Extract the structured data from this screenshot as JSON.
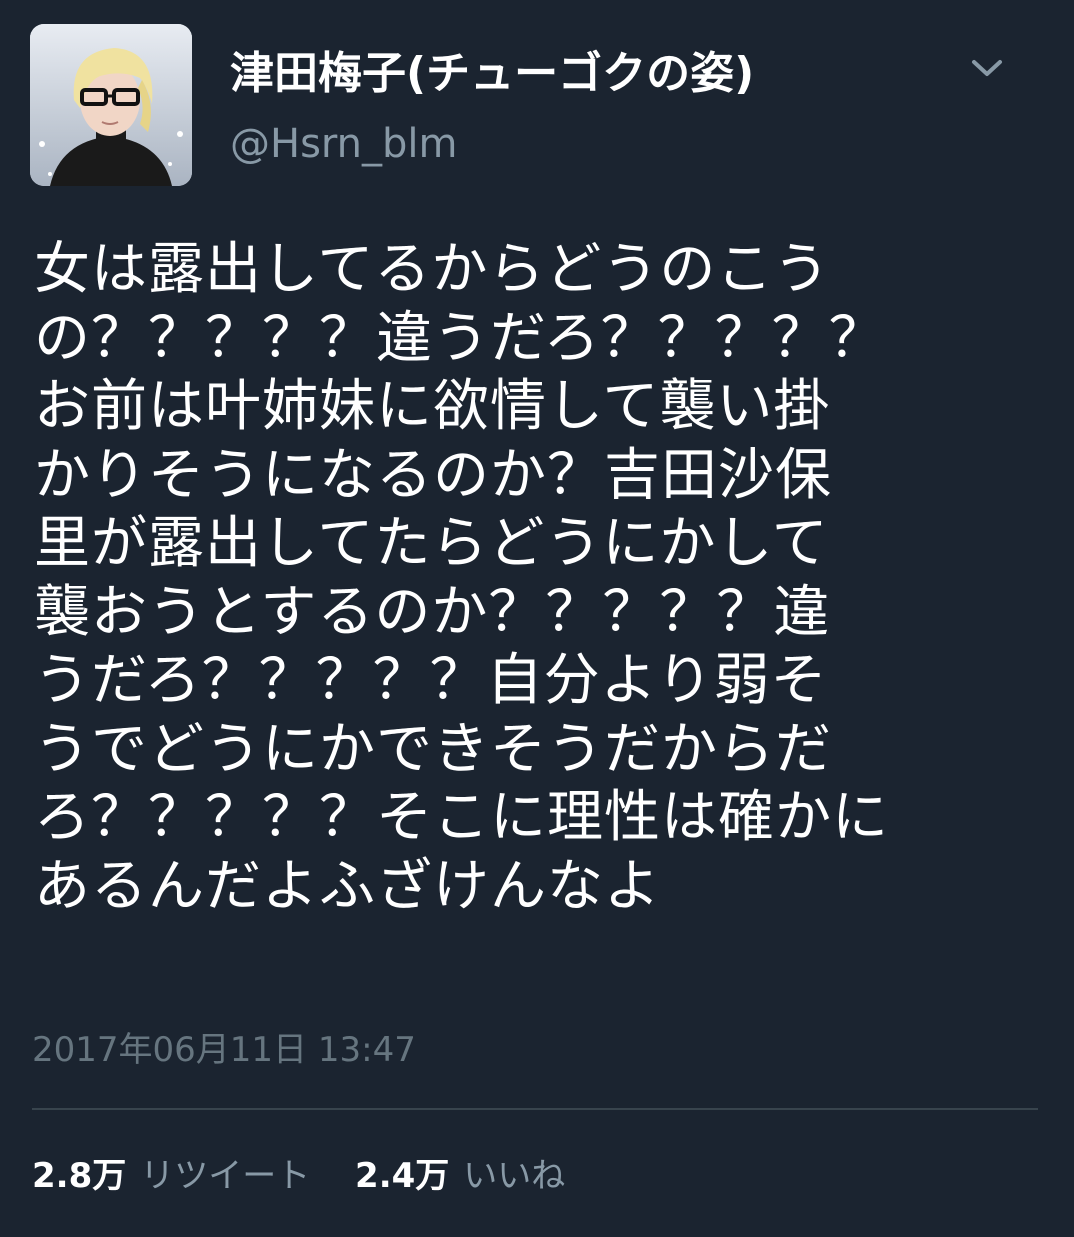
{
  "user": {
    "display_name": "津田梅子(チューゴクの姿)",
    "handle": "@Hsrn_blm",
    "avatar_icon": "user-avatar-photo"
  },
  "tweet": {
    "lines": [
      "女は露出してるからどうのこう",
      "の？？？？？違うだろ？？？？？",
      "お前は叶姉妹に欲情して襲い掛",
      "かりそうになるのか？吉田沙保",
      "里が露出してたらどうにかして",
      "襲おうとするのか？？？？？違",
      "うだろ？？？？？自分より弱そ",
      "うでどうにかできそうだからだ",
      "ろ？？？？？そこに理性は確かに",
      "あるんだよふざけんなよ"
    ],
    "timestamp": "2017年06月11日 13:47"
  },
  "stats": {
    "retweets_count": "2.8万",
    "retweets_label": "リツイート",
    "likes_count": "2.4万",
    "likes_label": "いいね"
  },
  "menu": {
    "icon": "chevron-down-icon"
  },
  "colors": {
    "background": "#1b2430",
    "text": "#ffffff",
    "secondary_text": "#8899a6",
    "timestamp_text": "#66757f",
    "divider": "#38444d"
  }
}
